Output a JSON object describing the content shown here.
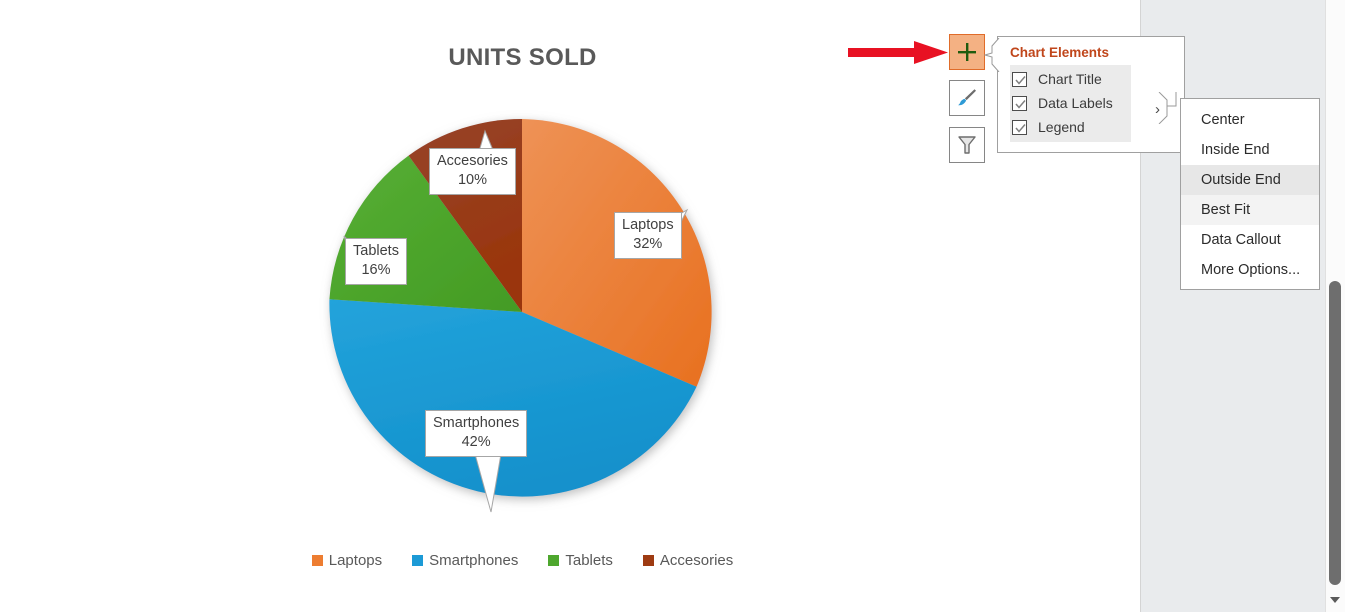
{
  "chart_data": {
    "type": "pie",
    "title": "UNITS SOLD",
    "categories": [
      "Laptops",
      "Smartphones",
      "Tablets",
      "Accesories"
    ],
    "values": [
      32,
      42,
      16,
      10
    ],
    "value_labels": [
      "32%",
      "42%",
      "16%",
      "10%"
    ],
    "colors": [
      "#ED7D31",
      "#1C9AD6",
      "#4EA72E",
      "#9E3B12"
    ],
    "legend_position": "bottom",
    "data_label_position": "Data Callout",
    "labels_show_category_and_percent": true
  },
  "slide": {
    "title": "UNITS SOLD"
  },
  "data_labels": [
    {
      "name": "Laptops",
      "percent": "32%"
    },
    {
      "name": "Smartphones",
      "percent": "42%"
    },
    {
      "name": "Tablets",
      "percent": "16%"
    },
    {
      "name": "Accesories",
      "percent": "10%"
    }
  ],
  "legend": {
    "items": [
      {
        "label": "Laptops",
        "color": "#ED7D31"
      },
      {
        "label": "Smartphones",
        "color": "#1C9AD6"
      },
      {
        "label": "Tablets",
        "color": "#4EA72E"
      },
      {
        "label": "Accesories",
        "color": "#9E3B12"
      }
    ]
  },
  "chart_buttons": [
    {
      "icon": "plus-icon",
      "title": "Chart Elements",
      "active": true
    },
    {
      "icon": "paintbrush-icon",
      "title": "Chart Styles",
      "active": false
    },
    {
      "icon": "funnel-icon",
      "title": "Chart Filters",
      "active": false
    }
  ],
  "chart_elements_panel": {
    "header": "Chart Elements",
    "items": [
      {
        "label": "Chart Title",
        "checked": true
      },
      {
        "label": "Data Labels",
        "checked": true,
        "has_submenu": true
      },
      {
        "label": "Legend",
        "checked": true
      }
    ],
    "submenu_chevron": "›"
  },
  "data_labels_submenu": {
    "items": [
      {
        "label": "Center",
        "highlight": "none"
      },
      {
        "label": "Inside End",
        "highlight": "none"
      },
      {
        "label": "Outside End",
        "highlight": "strong"
      },
      {
        "label": "Best Fit",
        "highlight": "soft"
      },
      {
        "label": "Data Callout",
        "highlight": "none"
      },
      {
        "label": "More Options...",
        "highlight": "none"
      }
    ]
  },
  "annotation": {
    "arrow_color": "#E81123",
    "points_to": "Chart Elements button"
  },
  "scrollbar": {
    "orientation": "vertical",
    "down_arrow": "▼"
  }
}
